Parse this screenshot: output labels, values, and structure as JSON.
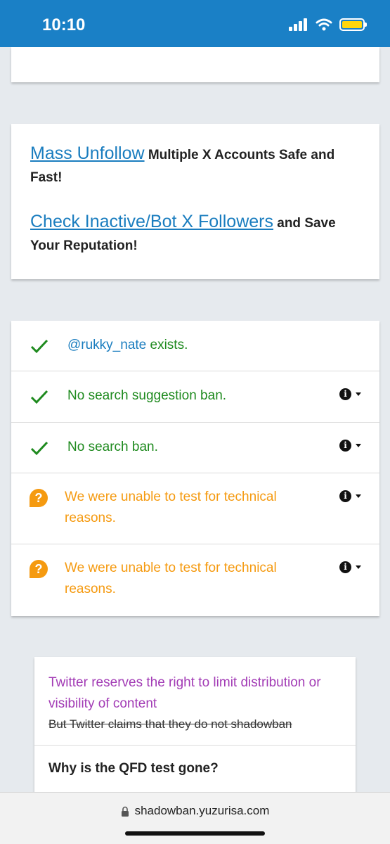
{
  "status_bar": {
    "time": "10:10"
  },
  "promo": {
    "line1_link": "Mass Unfollow",
    "line1_text": " Multiple X Accounts Safe and Fast!",
    "line2_link": "Check Inactive/Bot X Followers",
    "line2_text": " and Save Your Reputation!"
  },
  "results": [
    {
      "handle": "@rukky_nate",
      "text": " exists.",
      "status": "ok"
    },
    {
      "text": "No search suggestion ban.",
      "status": "ok"
    },
    {
      "text": "No search ban.",
      "status": "ok"
    },
    {
      "text": "We were unable to test for technical reasons.",
      "status": "unknown"
    },
    {
      "text": "We were unable to test for technical reasons.",
      "status": "unknown"
    }
  ],
  "faq": {
    "title": "Twitter reserves the right to limit distribution or visibility of content",
    "strike": "But Twitter claims that they do not shadowban",
    "question": "Why is the QFD test gone?"
  },
  "browser": {
    "url": "shadowban.yuzurisa.com"
  },
  "colors": {
    "accent": "#1a80c6",
    "ok": "#1e8a1e",
    "warning": "#f59a10",
    "faq_title": "#a23bb5"
  }
}
